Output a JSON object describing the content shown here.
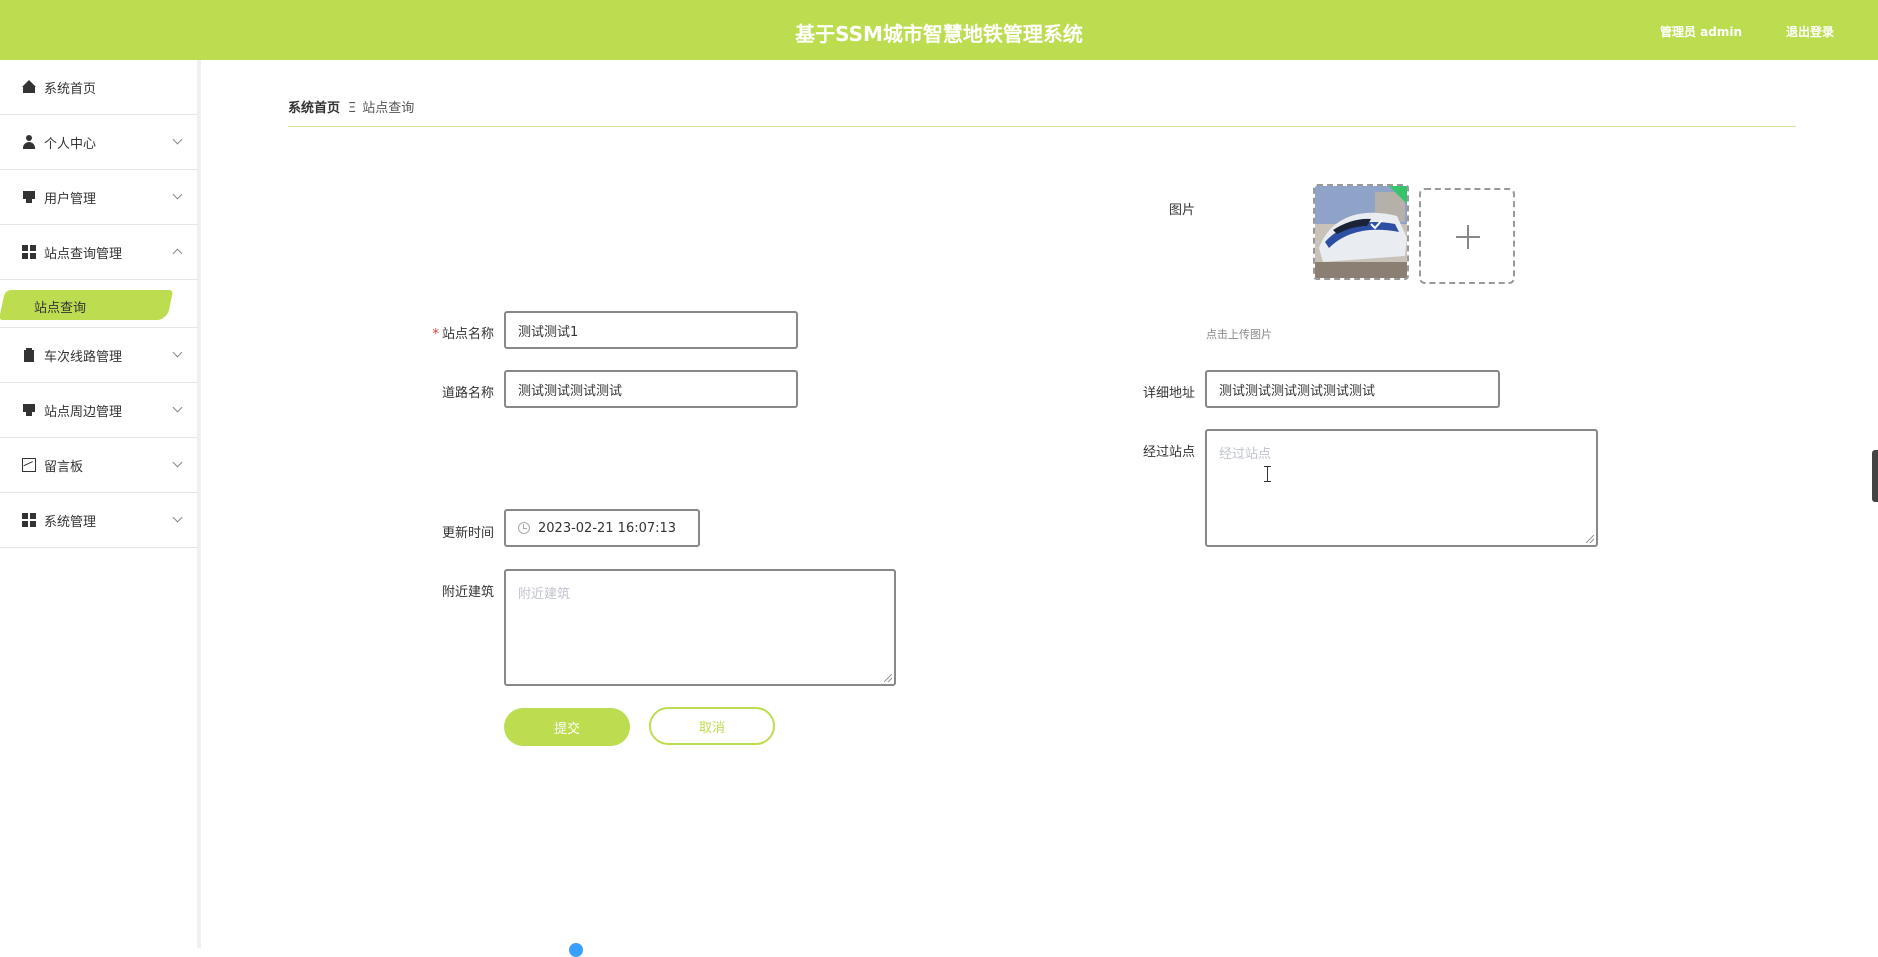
{
  "header": {
    "title": "基于SSM城市智慧地铁管理系统",
    "admin_label": "管理员 admin",
    "logout_label": "退出登录"
  },
  "sidebar": {
    "items": [
      {
        "label": "系统首页",
        "icon": "home-icon"
      },
      {
        "label": "个人中心",
        "icon": "user-icon"
      },
      {
        "label": "用户管理",
        "icon": "block-icon"
      },
      {
        "label": "站点查询管理",
        "icon": "grid-icon",
        "expanded": true
      },
      {
        "label": "站点查询",
        "sub": true,
        "active": true
      },
      {
        "label": "车次线路管理",
        "icon": "clipboard-icon"
      },
      {
        "label": "站点周边管理",
        "icon": "block-icon"
      },
      {
        "label": "留言板",
        "icon": "chart-icon"
      },
      {
        "label": "系统管理",
        "icon": "grid-icon"
      }
    ]
  },
  "breadcrumb": {
    "home": "系统首页",
    "separator": "Ξ",
    "current": "站点查询"
  },
  "form": {
    "station_name": {
      "label": "站点名称",
      "value": "测试测试1",
      "required": true
    },
    "road_name": {
      "label": "道路名称",
      "value": "测试测试测试测试"
    },
    "update_time": {
      "label": "更新时间",
      "value": "2023-02-21 16:07:13"
    },
    "nearby": {
      "label": "附近建筑",
      "placeholder": "附近建筑"
    },
    "image": {
      "label": "图片",
      "hint": "点击上传图片"
    },
    "address": {
      "label": "详细地址",
      "value": "测试测试测试测试测试测试"
    },
    "stations": {
      "label": "经过站点",
      "placeholder": "经过站点"
    },
    "submit_label": "提交",
    "cancel_label": "取消"
  },
  "colors": {
    "accent": "#bcdd4f",
    "required": "#ee3333"
  }
}
